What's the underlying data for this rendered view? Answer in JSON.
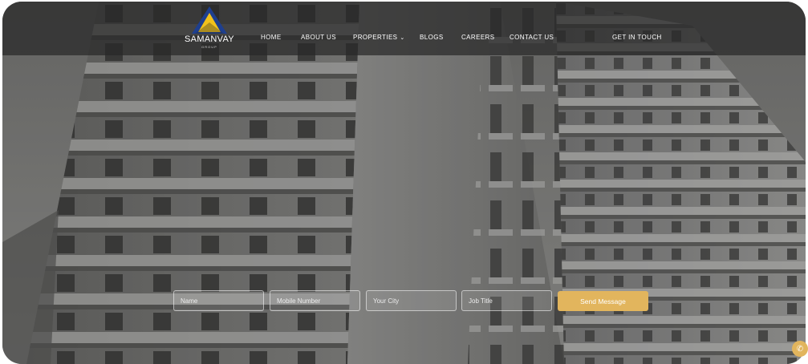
{
  "brand": {
    "name": "SAMANVAY",
    "tagline": "GROUP",
    "colors": {
      "logo_yellow": "#f2c21b",
      "logo_blue": "#1e3f8f",
      "accent_gold": "#e2b55d"
    }
  },
  "nav": {
    "items": [
      {
        "label": "HOME"
      },
      {
        "label": "ABOUT US"
      },
      {
        "label": "PROPERTIES"
      },
      {
        "label": "BLOGS"
      },
      {
        "label": "CAREERS"
      },
      {
        "label": "CONTACT US"
      }
    ],
    "properties_dropdown_icon": "chevron-down-icon",
    "cta_label": "GET IN TOUCH"
  },
  "hero": {
    "background": "grayscale high-rise apartment building"
  },
  "enquiry_form": {
    "name_placeholder": "Name",
    "mobile_placeholder": "Mobile Number",
    "city_placeholder": "Your City",
    "job_placeholder": "Job Title",
    "submit_label": "Send Message"
  },
  "floating_button": {
    "icon": "phone-icon",
    "glyph": "✆"
  }
}
